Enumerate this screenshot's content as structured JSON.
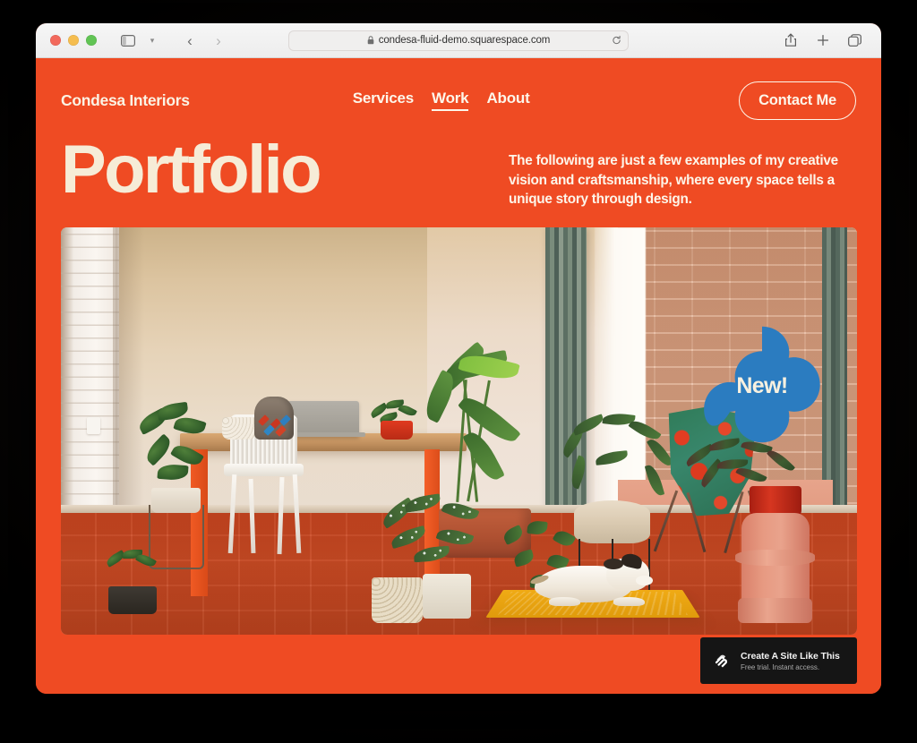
{
  "browser": {
    "traffic_lights": [
      "close",
      "minimize",
      "zoom"
    ],
    "sidebar_icon": "sidebar-icon",
    "sidebar_chevron": "chevron-down-icon",
    "back_label": "‹",
    "forward_label": "›",
    "address": {
      "url": "condesa-fluid-demo.squarespace.com",
      "lock_icon": "lock-icon",
      "reload_icon": "reload-icon"
    },
    "actions": [
      {
        "name": "share-icon",
        "label": "Share"
      },
      {
        "name": "new-tab-icon",
        "label": "New Tab"
      },
      {
        "name": "tab-overview-icon",
        "label": "Tab Overview"
      }
    ]
  },
  "site": {
    "brand": "Condesa Interiors",
    "nav": [
      {
        "label": "Services",
        "active": false
      },
      {
        "label": "Work",
        "active": true
      },
      {
        "label": "About",
        "active": false
      }
    ],
    "cta": "Contact Me",
    "hero": {
      "title": "Portfolio",
      "copy": "The following are just a few examples of my creative vision and craftsmanship, where every space tells a unique story through design."
    },
    "badge": {
      "label": "New!",
      "shape": "clover-blob",
      "color": "#2b7cc0"
    },
    "photo": {
      "alt": "Interior room with wooden desk, laptop, white chair, many houseplants, floral butterfly chair and a dog on a yellow mat"
    },
    "promo": {
      "logo": "squarespace-logo-icon",
      "title": "Create A Site Like This",
      "subtitle": "Free trial. Instant access."
    }
  },
  "colors": {
    "brand_orange": "#ef4b23",
    "cream": "#fdf6ea",
    "hero_cream": "#f6ecd7",
    "badge_blue": "#2b7cc0",
    "promo_bg": "#151515",
    "page_black": "#050505"
  }
}
